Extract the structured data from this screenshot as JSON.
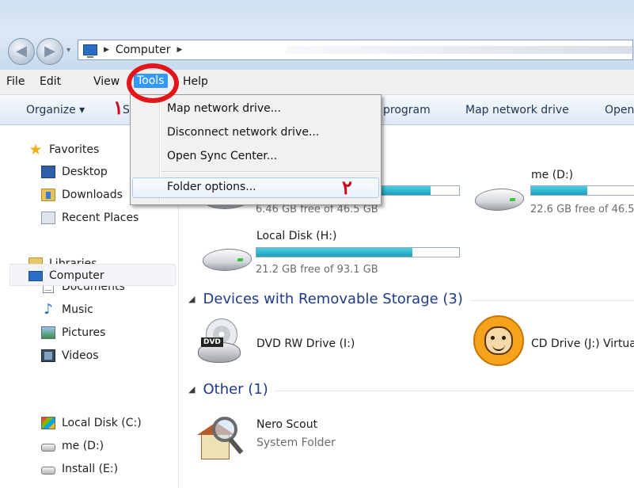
{
  "window": {
    "nav_back_glyph": "◀",
    "nav_forward_glyph": "▶",
    "nav_dropdown_glyph": "▾"
  },
  "address": {
    "separator": "▶",
    "location": "Computer",
    "trail_separator": "▶"
  },
  "menubar": {
    "items": [
      {
        "label": "File"
      },
      {
        "label": "Edit"
      },
      {
        "label": "View"
      },
      {
        "label": "Tools"
      },
      {
        "label": "Help"
      }
    ]
  },
  "annotations": {
    "step_one": "۱",
    "step_two": "۲",
    "highlight_color": "#e3151a"
  },
  "toolbar": {
    "organize": "Organize ▾",
    "organize_partial": "S",
    "program": "program",
    "map_network_drive": "Map network drive",
    "open_partial": "Open"
  },
  "tools_menu": {
    "items": [
      {
        "label": "Map network drive..."
      },
      {
        "label": "Disconnect network drive..."
      },
      {
        "label": "Open Sync Center..."
      },
      {
        "label": "Folder options..."
      }
    ]
  },
  "navigation": {
    "favorites": {
      "header": "Favorites",
      "items": [
        {
          "label": "Desktop",
          "icon": "desktop-icon"
        },
        {
          "label": "Downloads",
          "icon": "downloads-icon"
        },
        {
          "label": "Recent Places",
          "icon": "recent-places-icon"
        }
      ]
    },
    "libraries": {
      "header": "Libraries",
      "items": [
        {
          "label": "Documents",
          "icon": "documents-icon"
        },
        {
          "label": "Music",
          "icon": "music-icon"
        },
        {
          "label": "Pictures",
          "icon": "pictures-icon"
        },
        {
          "label": "Videos",
          "icon": "videos-icon"
        }
      ]
    },
    "computer": {
      "header": "Computer",
      "items": [
        {
          "label": "Local Disk (C:)",
          "icon": "system-drive-icon"
        },
        {
          "label": "me (D:)",
          "icon": "drive-icon"
        },
        {
          "label": "Install (E:)",
          "icon": "drive-icon"
        }
      ]
    }
  },
  "content": {
    "hard_disks": [
      {
        "name": "",
        "free": "6.46 GB free of 46.5 GB",
        "used_fraction": 0.86
      },
      {
        "name": "me (D:)",
        "free": "22.6 GB free of 46.5",
        "used_fraction": 0.51
      },
      {
        "name": "Local Disk (H:)",
        "free": "21.2 GB free of 93.1 GB",
        "used_fraction": 0.77
      }
    ],
    "removable_group": {
      "arrow": "◢",
      "header": "Devices with Removable Storage (3)"
    },
    "removable": [
      {
        "name": "DVD RW Drive (I:)",
        "badge": "DVD"
      },
      {
        "name": "CD Drive (J:) Virtua"
      }
    ],
    "other_group": {
      "arrow": "◢",
      "header": "Other (1)"
    },
    "other": [
      {
        "name": "Nero Scout",
        "type": "System Folder"
      }
    ]
  },
  "colors": {
    "menu_active": "#3399ff",
    "bar_fill": "#26b0cc",
    "group_header": "#1e3a8a"
  }
}
